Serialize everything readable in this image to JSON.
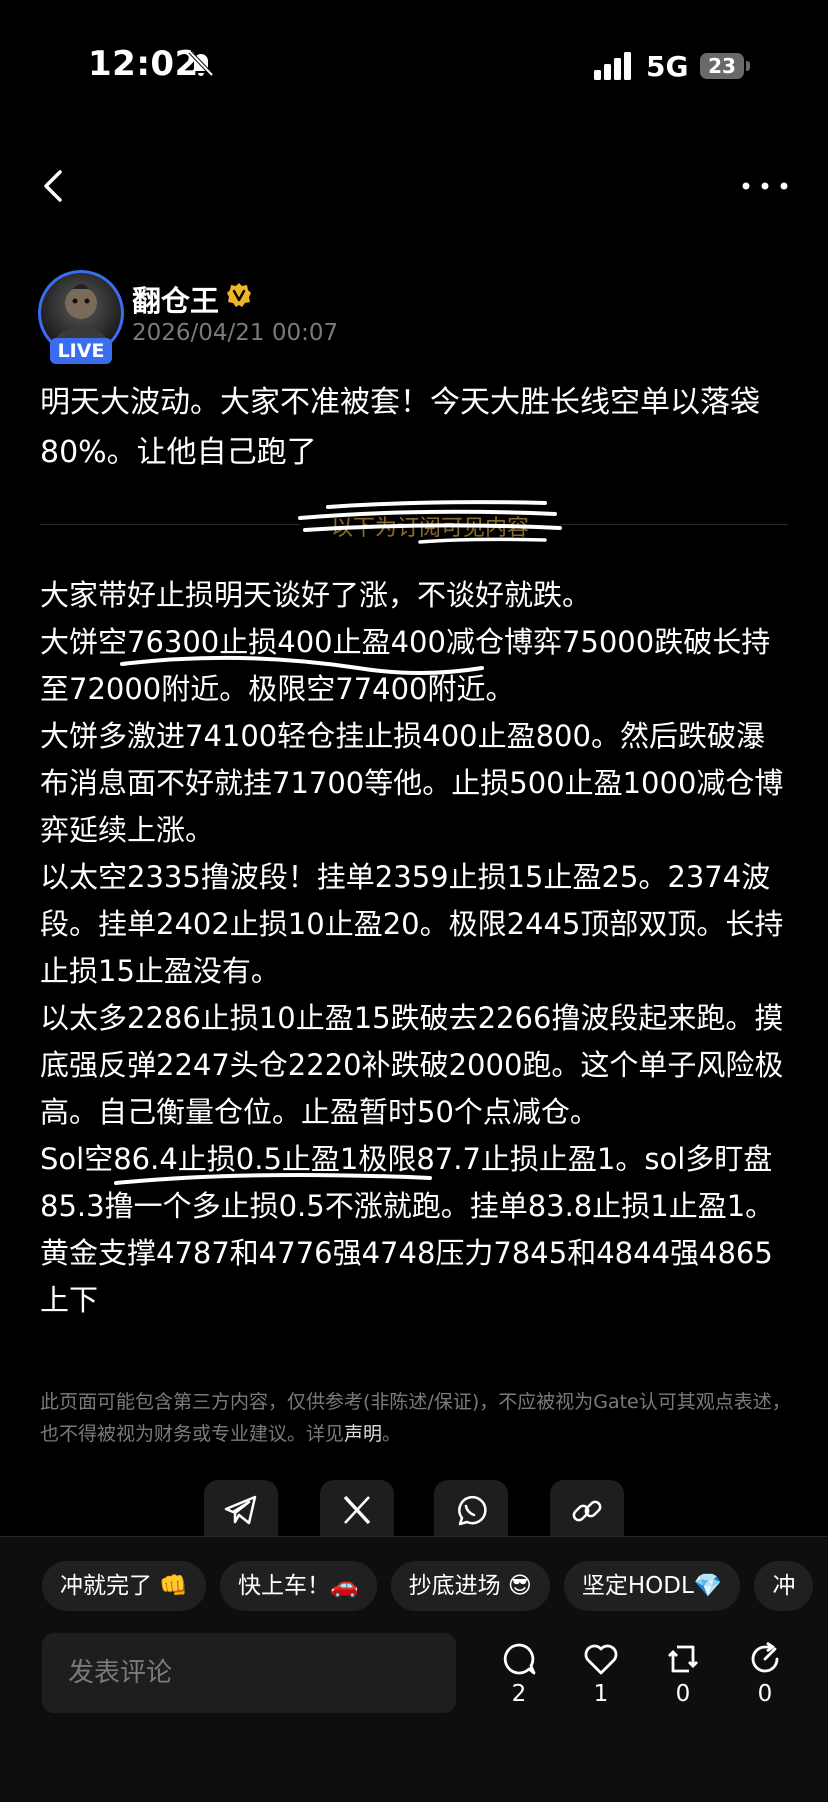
{
  "status_bar": {
    "time": "12:02",
    "network": "5G",
    "battery": "23"
  },
  "author": {
    "name": "翻仓王",
    "live_badge": "LIVE",
    "date": "2026/04/21 00:07"
  },
  "post": {
    "intro": "明天大波动。大家不准被套！今天大胜长线空单以落袋80%。让他自己跑了",
    "divider_label": "以下为订阅可见内容",
    "paragraphs": [
      "大家带好止损明天谈好了涨，不谈好就跌。",
      "大饼空76300止损400止盈400减仓博弈75000跌破长持至72000附近。极限空77400附近。",
      "大饼多激进74100轻仓挂止损400止盈800。然后跌破瀑布消息面不好就挂71700等他。止损500止盈1000减仓博弈延续上涨。",
      "以太空2335撸波段！挂单2359止损15止盈25。2374波段。挂单2402止损10止盈20。极限2445顶部双顶。长持止损15止盈没有。",
      "以太多2286止损10止盈15跌破去2266撸波段起来跑。摸底强反弹2247头仓2220补跌破2000跑。这个单子风险极高。自己衡量仓位。止盈暂时50个点减仓。",
      "Sol空86.4止损0.5止盈1极限87.7止损止盈1。sol多盯盘85.3撸一个多止损0.5不涨就跑。挂单83.8止损1止盈1。",
      "黄金支撑4787和4776强4748压力7845和4844强4865上下"
    ]
  },
  "disclaimer": {
    "text": "此页面可能包含第三方内容，仅供参考(非陈述/保证)，不应被视为Gate认可其观点表述，也不得被视为财务或专业建议。详见",
    "link": "声明",
    "end": "。"
  },
  "share": [
    {
      "icon": "telegram-icon"
    },
    {
      "icon": "x-icon"
    },
    {
      "icon": "whatsapp-icon"
    },
    {
      "icon": "link-icon"
    }
  ],
  "chips": [
    "冲就完了 👊",
    "快上车！🚗",
    "抄底进场 😎",
    "坚定HODL💎",
    "冲"
  ],
  "comment": {
    "placeholder": "发表评论"
  },
  "actions": [
    {
      "name": "comment",
      "count": "2"
    },
    {
      "name": "like",
      "count": "1"
    },
    {
      "name": "repost",
      "count": "0"
    },
    {
      "name": "share",
      "count": "0"
    }
  ],
  "colors": {
    "accent": "#3a6df0",
    "verified": "#f0b429",
    "background": "#000000"
  }
}
